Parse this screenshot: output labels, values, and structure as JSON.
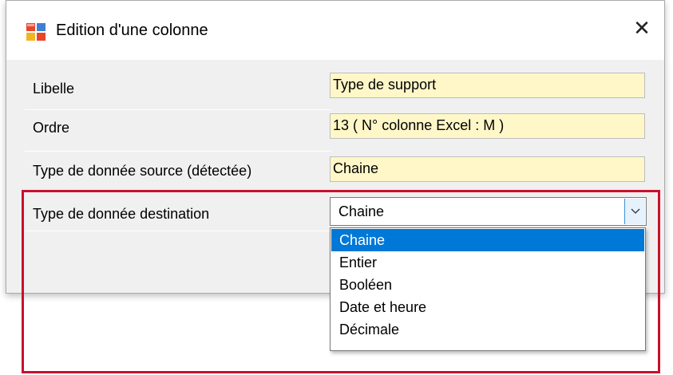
{
  "window": {
    "title": "Edition d'une colonne",
    "close_glyph": "✕",
    "icon": "form-app-icon"
  },
  "form": {
    "libelle": {
      "label": "Libelle",
      "value": "Type de support"
    },
    "ordre": {
      "label": "Ordre",
      "value": "13 ( N° colonne Excel : M )"
    },
    "type_source": {
      "label": "Type de donnée source (détectée)",
      "value": "Chaine"
    },
    "type_destination": {
      "label": "Type de donnée destination",
      "value": "Chaine",
      "options": [
        "Chaine",
        "Entier",
        "Booléen",
        "Date et heure",
        "Décimale"
      ],
      "selected_option": "Chaine"
    }
  },
  "colors": {
    "readonly_field_bg": "#fff7c8",
    "selection_bg": "#0078d7",
    "highlight_border": "#c8102e",
    "dialog_bg": "#f0f0f0"
  }
}
